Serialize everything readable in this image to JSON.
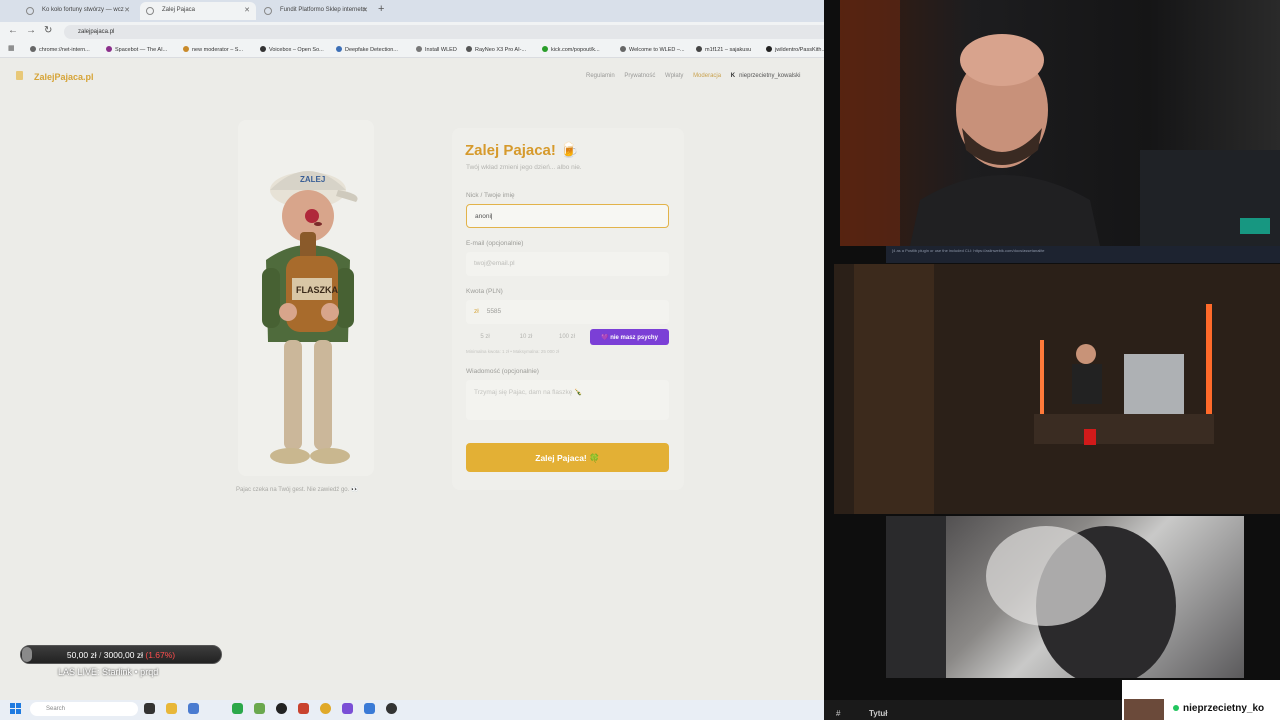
{
  "browser": {
    "tabs": [
      {
        "label": "Ko koło fortuny stwórzy — wcz",
        "active": false
      },
      {
        "label": "Zalej Pajaca",
        "active": true
      },
      {
        "label": "Fundit Platformo Sklep internetn",
        "active": false
      }
    ],
    "url": "zalejpajaca.pl",
    "bookmarks": [
      "chrome://net-intern...",
      "Spacebot — The AI...",
      "new moderator – S...",
      "Voicebox – Open So...",
      "Deepfake Detection...",
      "Install WLED",
      "RayNeo X3 Pro AI-...",
      "kick.com/popout/k...",
      "Welcome to WLED –...",
      "m1f121 – sajakusu",
      "jwildentro/PassKith..."
    ]
  },
  "site": {
    "logo": "ZalejPajaca.pl",
    "nav": {
      "regulamin": "Regulamin",
      "prywatnosc": "Prywatność",
      "wplaty": "Wpłaty",
      "moderacja": "Moderacja",
      "k": "K",
      "user": "nieprzecietny_kowalski"
    },
    "mascot_caption": "Pajac czeka na Twój gest. Nie zawiedź go. 👀",
    "form": {
      "title": "Zalej Pajaca! 🍺",
      "subtitle": "Twój wkład zmieni jego dzień... albo nie.",
      "nick_label": "Nick / Twoje imię",
      "nick_value": "anoni",
      "email_label": "E-mail (opcjonalnie)",
      "email_placeholder": "twoj@email.pl",
      "amount_label": "Kwota (PLN)",
      "amount_currency": "zł",
      "amount_value": "5585",
      "chips": [
        "5 zł",
        "10 zł",
        "100 zł"
      ],
      "psycho_chip": "💜 nie masz psychy",
      "amount_hint": "Minimalna kwota: 1 zł • Maksymalna: 25 000 zł",
      "message_label": "Wiadomość (opcjonalnie)",
      "message_placeholder": "Trzymaj się Pajac, dam na flaszkę 🍾",
      "submit": "Zalej Pajaca! 🍀"
    }
  },
  "overlay": {
    "goal_current": "50,00 zł",
    "goal_separator": "/",
    "goal_target": "3000,00 zł",
    "goal_percent": "(1.67%)",
    "goal_fraction": 0.0167,
    "live_title": "LAS LIVE: Starlink • prqd"
  },
  "taskbar": {
    "search_placeholder": "Search"
  },
  "stream_panel": {
    "terminal_line": "[4 as a Postlib plugin or use the included CLI: https://aslinwebik.com/docs/assetanalite",
    "chat_hash": "#",
    "chat_title": "Tytuł",
    "username": "nieprzecietny_ko"
  },
  "colors": {
    "accent": "#e3b035",
    "brand_logo": "#d6a437",
    "psycho": "#7b3fd6",
    "goal_pct": "#ff4d4d",
    "online": "#22c55e"
  }
}
